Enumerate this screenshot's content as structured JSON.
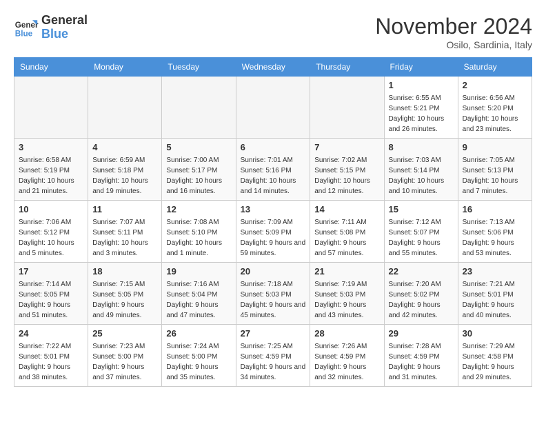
{
  "header": {
    "logo_line1": "General",
    "logo_line2": "Blue",
    "month": "November 2024",
    "location": "Osilo, Sardinia, Italy"
  },
  "weekdays": [
    "Sunday",
    "Monday",
    "Tuesday",
    "Wednesday",
    "Thursday",
    "Friday",
    "Saturday"
  ],
  "weeks": [
    [
      {
        "day": "",
        "info": ""
      },
      {
        "day": "",
        "info": ""
      },
      {
        "day": "",
        "info": ""
      },
      {
        "day": "",
        "info": ""
      },
      {
        "day": "",
        "info": ""
      },
      {
        "day": "1",
        "info": "Sunrise: 6:55 AM\nSunset: 5:21 PM\nDaylight: 10 hours and 26 minutes."
      },
      {
        "day": "2",
        "info": "Sunrise: 6:56 AM\nSunset: 5:20 PM\nDaylight: 10 hours and 23 minutes."
      }
    ],
    [
      {
        "day": "3",
        "info": "Sunrise: 6:58 AM\nSunset: 5:19 PM\nDaylight: 10 hours and 21 minutes."
      },
      {
        "day": "4",
        "info": "Sunrise: 6:59 AM\nSunset: 5:18 PM\nDaylight: 10 hours and 19 minutes."
      },
      {
        "day": "5",
        "info": "Sunrise: 7:00 AM\nSunset: 5:17 PM\nDaylight: 10 hours and 16 minutes."
      },
      {
        "day": "6",
        "info": "Sunrise: 7:01 AM\nSunset: 5:16 PM\nDaylight: 10 hours and 14 minutes."
      },
      {
        "day": "7",
        "info": "Sunrise: 7:02 AM\nSunset: 5:15 PM\nDaylight: 10 hours and 12 minutes."
      },
      {
        "day": "8",
        "info": "Sunrise: 7:03 AM\nSunset: 5:14 PM\nDaylight: 10 hours and 10 minutes."
      },
      {
        "day": "9",
        "info": "Sunrise: 7:05 AM\nSunset: 5:13 PM\nDaylight: 10 hours and 7 minutes."
      }
    ],
    [
      {
        "day": "10",
        "info": "Sunrise: 7:06 AM\nSunset: 5:12 PM\nDaylight: 10 hours and 5 minutes."
      },
      {
        "day": "11",
        "info": "Sunrise: 7:07 AM\nSunset: 5:11 PM\nDaylight: 10 hours and 3 minutes."
      },
      {
        "day": "12",
        "info": "Sunrise: 7:08 AM\nSunset: 5:10 PM\nDaylight: 10 hours and 1 minute."
      },
      {
        "day": "13",
        "info": "Sunrise: 7:09 AM\nSunset: 5:09 PM\nDaylight: 9 hours and 59 minutes."
      },
      {
        "day": "14",
        "info": "Sunrise: 7:11 AM\nSunset: 5:08 PM\nDaylight: 9 hours and 57 minutes."
      },
      {
        "day": "15",
        "info": "Sunrise: 7:12 AM\nSunset: 5:07 PM\nDaylight: 9 hours and 55 minutes."
      },
      {
        "day": "16",
        "info": "Sunrise: 7:13 AM\nSunset: 5:06 PM\nDaylight: 9 hours and 53 minutes."
      }
    ],
    [
      {
        "day": "17",
        "info": "Sunrise: 7:14 AM\nSunset: 5:05 PM\nDaylight: 9 hours and 51 minutes."
      },
      {
        "day": "18",
        "info": "Sunrise: 7:15 AM\nSunset: 5:05 PM\nDaylight: 9 hours and 49 minutes."
      },
      {
        "day": "19",
        "info": "Sunrise: 7:16 AM\nSunset: 5:04 PM\nDaylight: 9 hours and 47 minutes."
      },
      {
        "day": "20",
        "info": "Sunrise: 7:18 AM\nSunset: 5:03 PM\nDaylight: 9 hours and 45 minutes."
      },
      {
        "day": "21",
        "info": "Sunrise: 7:19 AM\nSunset: 5:03 PM\nDaylight: 9 hours and 43 minutes."
      },
      {
        "day": "22",
        "info": "Sunrise: 7:20 AM\nSunset: 5:02 PM\nDaylight: 9 hours and 42 minutes."
      },
      {
        "day": "23",
        "info": "Sunrise: 7:21 AM\nSunset: 5:01 PM\nDaylight: 9 hours and 40 minutes."
      }
    ],
    [
      {
        "day": "24",
        "info": "Sunrise: 7:22 AM\nSunset: 5:01 PM\nDaylight: 9 hours and 38 minutes."
      },
      {
        "day": "25",
        "info": "Sunrise: 7:23 AM\nSunset: 5:00 PM\nDaylight: 9 hours and 37 minutes."
      },
      {
        "day": "26",
        "info": "Sunrise: 7:24 AM\nSunset: 5:00 PM\nDaylight: 9 hours and 35 minutes."
      },
      {
        "day": "27",
        "info": "Sunrise: 7:25 AM\nSunset: 4:59 PM\nDaylight: 9 hours and 34 minutes."
      },
      {
        "day": "28",
        "info": "Sunrise: 7:26 AM\nSunset: 4:59 PM\nDaylight: 9 hours and 32 minutes."
      },
      {
        "day": "29",
        "info": "Sunrise: 7:28 AM\nSunset: 4:59 PM\nDaylight: 9 hours and 31 minutes."
      },
      {
        "day": "30",
        "info": "Sunrise: 7:29 AM\nSunset: 4:58 PM\nDaylight: 9 hours and 29 minutes."
      }
    ]
  ]
}
